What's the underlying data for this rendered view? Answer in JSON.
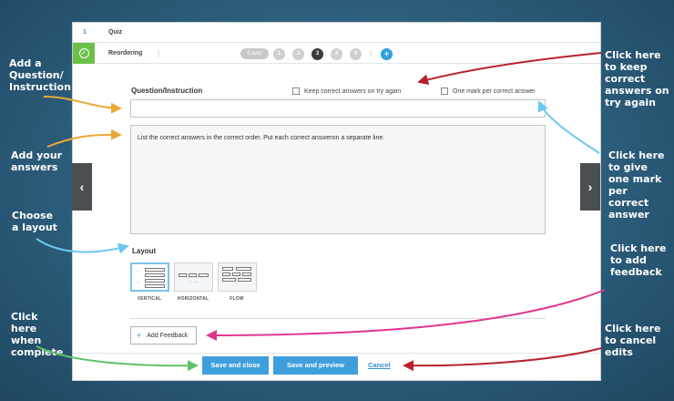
{
  "header": {
    "question_number": "1",
    "title": "Quiz"
  },
  "question": {
    "type_label": "Reordering",
    "cover_label": "Cover",
    "steps": [
      "1",
      "2",
      "3",
      "4",
      "5"
    ],
    "active_step": "3",
    "add_symbol": "+"
  },
  "form": {
    "question_label": "Question/Instruction",
    "keep_correct_label": "Keep correct answers on try again",
    "one_mark_label": "One mark per correct answer",
    "question_value": "",
    "answers_text": "List the correct answers in the correct order. Put each correct answeron a separate line.",
    "layout_label": "Layout",
    "layout_options": [
      "VERTICAL",
      "HORIZONTAL",
      "FLOW"
    ],
    "selected_layout": "VERTICAL",
    "add_feedback_label": "Add Feedback"
  },
  "buttons": {
    "save_close": "Save and close",
    "save_preview": "Save and preview",
    "cancel": "Cancel"
  },
  "nav": {
    "prev": "‹",
    "next": "›"
  },
  "annotations": {
    "add_question": "Add a Question/ Instruction",
    "add_answers": "Add your answers",
    "choose_layout": "Choose a layout",
    "click_complete": "Click here when complete",
    "keep_correct": "Click here to keep correct answers on try again",
    "one_mark": "Click here to give one mark per correct answer",
    "add_feedback": "Click here to add feedback",
    "cancel_edits": "Click here to cancel edits"
  },
  "colors": {
    "accent": "#3f9fdc",
    "success": "#6cc04a",
    "arrow_orange": "#e8a93a",
    "arrow_blue": "#6cc8f0",
    "arrow_red": "#b8222e",
    "arrow_pink": "#e0358f",
    "arrow_green": "#5fc26a"
  }
}
